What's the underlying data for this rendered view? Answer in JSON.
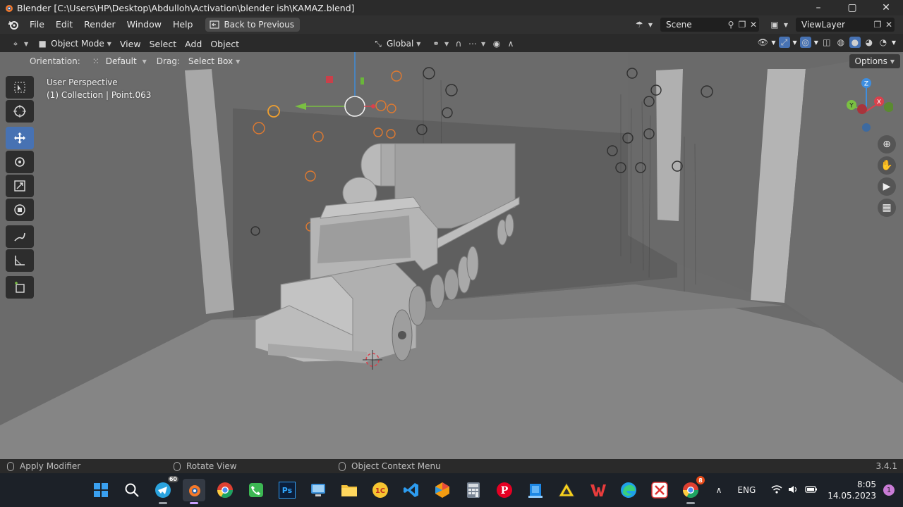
{
  "window": {
    "title": "Blender [C:\\Users\\HP\\Desktop\\Abdulloh\\Activation\\blender ish\\KAMAZ.blend]",
    "controls": [
      "–",
      "▢",
      "✕"
    ]
  },
  "menu": {
    "items": [
      "File",
      "Edit",
      "Render",
      "Window",
      "Help"
    ],
    "back_button": "Back to Previous",
    "scene": "Scene",
    "view_layer": "ViewLayer"
  },
  "viewport_header": {
    "mode": "Object Mode",
    "menus": [
      "View",
      "Select",
      "Add",
      "Object"
    ],
    "transform_orientation": "Global"
  },
  "tool_settings": {
    "orientation_label": "Orientation:",
    "orientation_value": "Default",
    "drag_label": "Drag:",
    "drag_value": "Select Box",
    "options_label": "Options"
  },
  "overlay": {
    "view_name": "User Perspective",
    "collection": "(1) Collection | Point.063"
  },
  "gizmo": {
    "axis_x": "X",
    "axis_y": "Y",
    "axis_z": "Z"
  },
  "statusbar": {
    "left": "Apply Modifier",
    "middle": "Rotate View",
    "right": "Object Context Menu",
    "version": "3.4.1"
  },
  "taskbar": {
    "telegram_badge": "60",
    "chrome_badge": "8",
    "language": "ENG",
    "time": "8:05",
    "date": "14.05.2023",
    "notifications": "1"
  },
  "colors": {
    "active_tool": "#4772b3",
    "viewport_bg": "#6e6e6e",
    "x_axis": "#d9414c",
    "y_axis": "#7ac042",
    "z_axis": "#3d8ee0"
  }
}
